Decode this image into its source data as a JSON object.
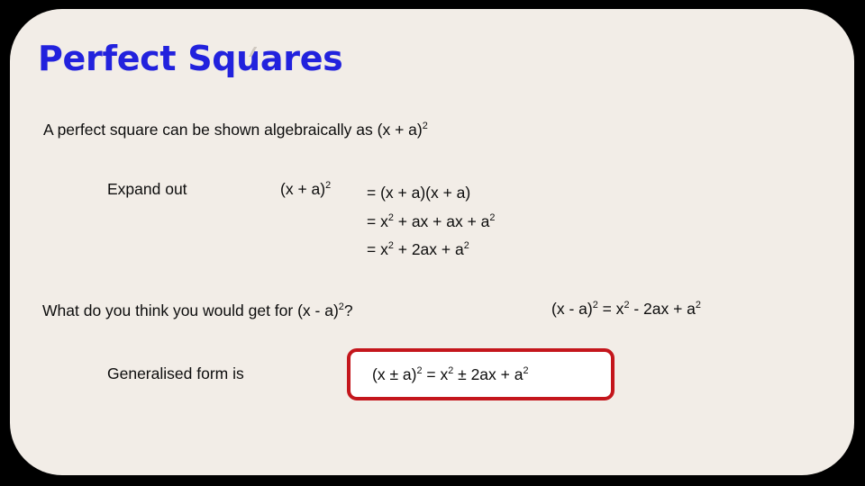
{
  "slide": {
    "title": "Perfect Squares",
    "title_color": "#2222DD",
    "background_color": "#F2EDE7",
    "outer_background_color": "#000000",
    "accent_color": "#C4161C"
  },
  "content": {
    "intro": {
      "text_before": "A perfect square can be shown algebraically as (x + a)",
      "exponent": "2"
    },
    "expand": {
      "label": "Expand out",
      "lhs_base": "(x + a)",
      "lhs_exponent": "2",
      "steps": [
        {
          "prefix": "= (x + a)(x + a)"
        },
        {
          "prefix": "= x",
          "sup1": "2",
          "mid": " + ax + ax + a",
          "sup2": "2"
        },
        {
          "prefix": "= x",
          "sup1": "2",
          "mid": " + 2ax + a",
          "sup2": "2"
        }
      ],
      "step1_full": "= (x + a)(x + a)",
      "step2_a": "= x",
      "step2_sup1": "2",
      "step2_b": " + ax + ax + a",
      "step2_sup2": "2",
      "step3_a": "= x",
      "step3_sup1": "2",
      "step3_b": " + 2ax + a",
      "step3_sup2": "2"
    },
    "question": {
      "text_before": "What do you think you would get for (x - a)",
      "exponent": "2",
      "text_after": "?"
    },
    "minus_result": {
      "a": "(x - a)",
      "sup1": "2",
      "b": " = x",
      "sup2": "2",
      "c": " - 2ax + a",
      "sup3": "2"
    },
    "generalised": {
      "label": "Generalised form is",
      "formula_a": "(x ± a)",
      "formula_sup1": "2",
      "formula_b": " = x",
      "formula_sup2": "2",
      "formula_c": " ± 2ax + a",
      "formula_sup3": "2"
    }
  }
}
